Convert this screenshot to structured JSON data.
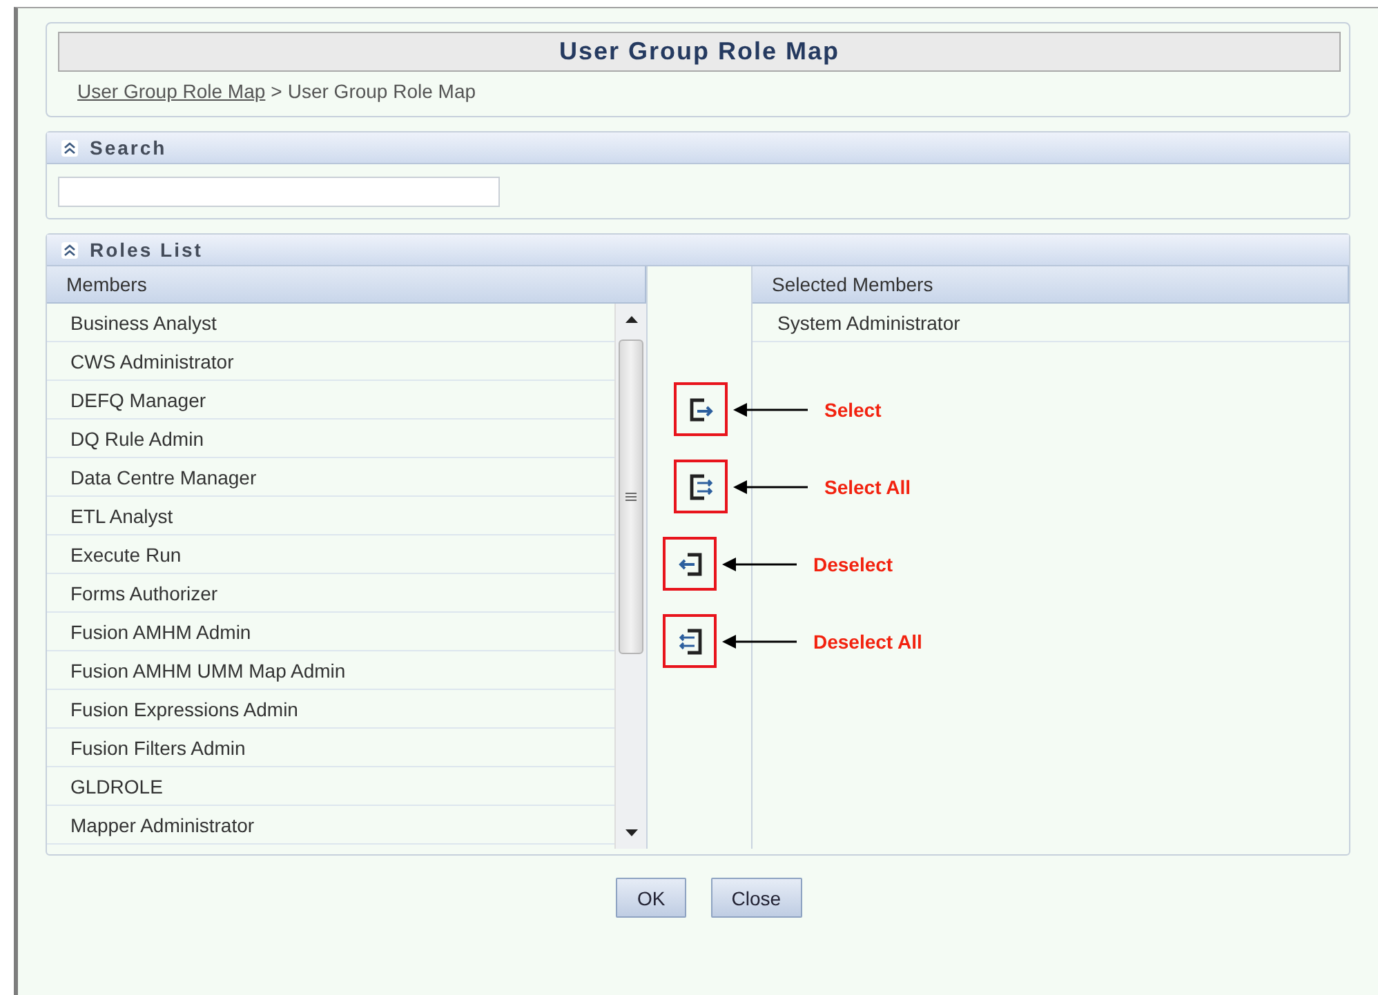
{
  "header": {
    "title": "User Group Role Map",
    "breadcrumb": [
      {
        "label": "User Group Role Map",
        "link": true
      },
      {
        "label": "User Group Role Map",
        "link": false
      }
    ],
    "separator": ">"
  },
  "search": {
    "title": "Search",
    "expanded": true
  },
  "roles_list": {
    "title": "Roles List",
    "expanded": true,
    "members": {
      "heading": "Members",
      "items": [
        "Business Analyst",
        "CWS Administrator",
        "DEFQ Manager",
        "DQ Rule Admin",
        "Data Centre Manager",
        "ETL Analyst",
        "Execute Run",
        "Forms Authorizer",
        "Fusion AMHM Admin",
        "Fusion AMHM UMM Map Admin",
        "Fusion Expressions Admin",
        "Fusion Filters Admin",
        "GLDROLE",
        "Mapper Administrator"
      ]
    },
    "transfer_buttons": [
      {
        "kind": "select",
        "annotation": "Select"
      },
      {
        "kind": "select_all",
        "annotation": "Select All"
      },
      {
        "kind": "deselect",
        "annotation": "Deselect"
      },
      {
        "kind": "deselect_all",
        "annotation": "Deselect All"
      }
    ],
    "selected_members": {
      "heading": "Selected Members",
      "items": [
        "System Administrator"
      ]
    }
  },
  "buttons": [
    "OK",
    "Close"
  ]
}
